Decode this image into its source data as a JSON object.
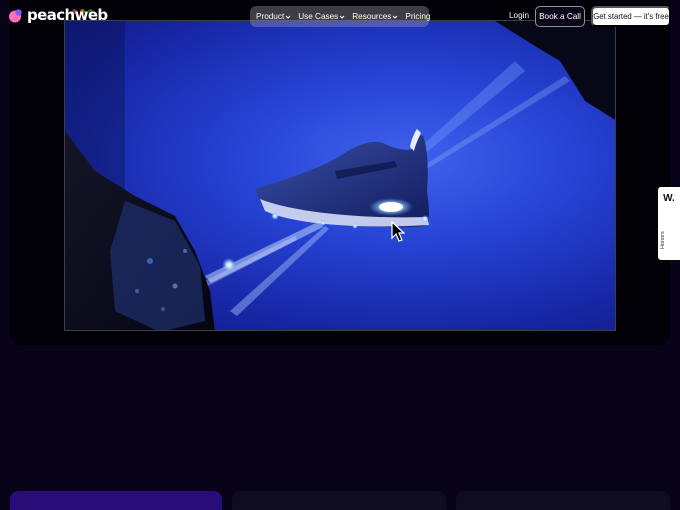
{
  "header": {
    "logo_text": "peachweb",
    "nav": [
      {
        "label": "Product",
        "has_dropdown": true
      },
      {
        "label": "Use Cases",
        "has_dropdown": true
      },
      {
        "label": "Resources",
        "has_dropdown": true
      },
      {
        "label": "Pricing",
        "has_dropdown": false
      }
    ],
    "login_label": "Login",
    "book_call_label": "Book a Call",
    "get_started_label": "Get started — it's free"
  },
  "side_widget": {
    "logo_letter": "W.",
    "label": "Honors"
  },
  "cards": [
    {
      "title": ""
    },
    {
      "title": ""
    },
    {
      "title": ""
    }
  ],
  "colors": {
    "page_bg": "#080318",
    "hero_blue": "#2643d4",
    "accent_purple": "#2a0c78",
    "logo_pink": "#ff6fb5",
    "logo_purple": "#7d5cff"
  },
  "icons": {
    "logo": "peach-logo-icon",
    "dropdown": "chevron-down-icon",
    "cursor": "mouse-pointer-icon"
  }
}
